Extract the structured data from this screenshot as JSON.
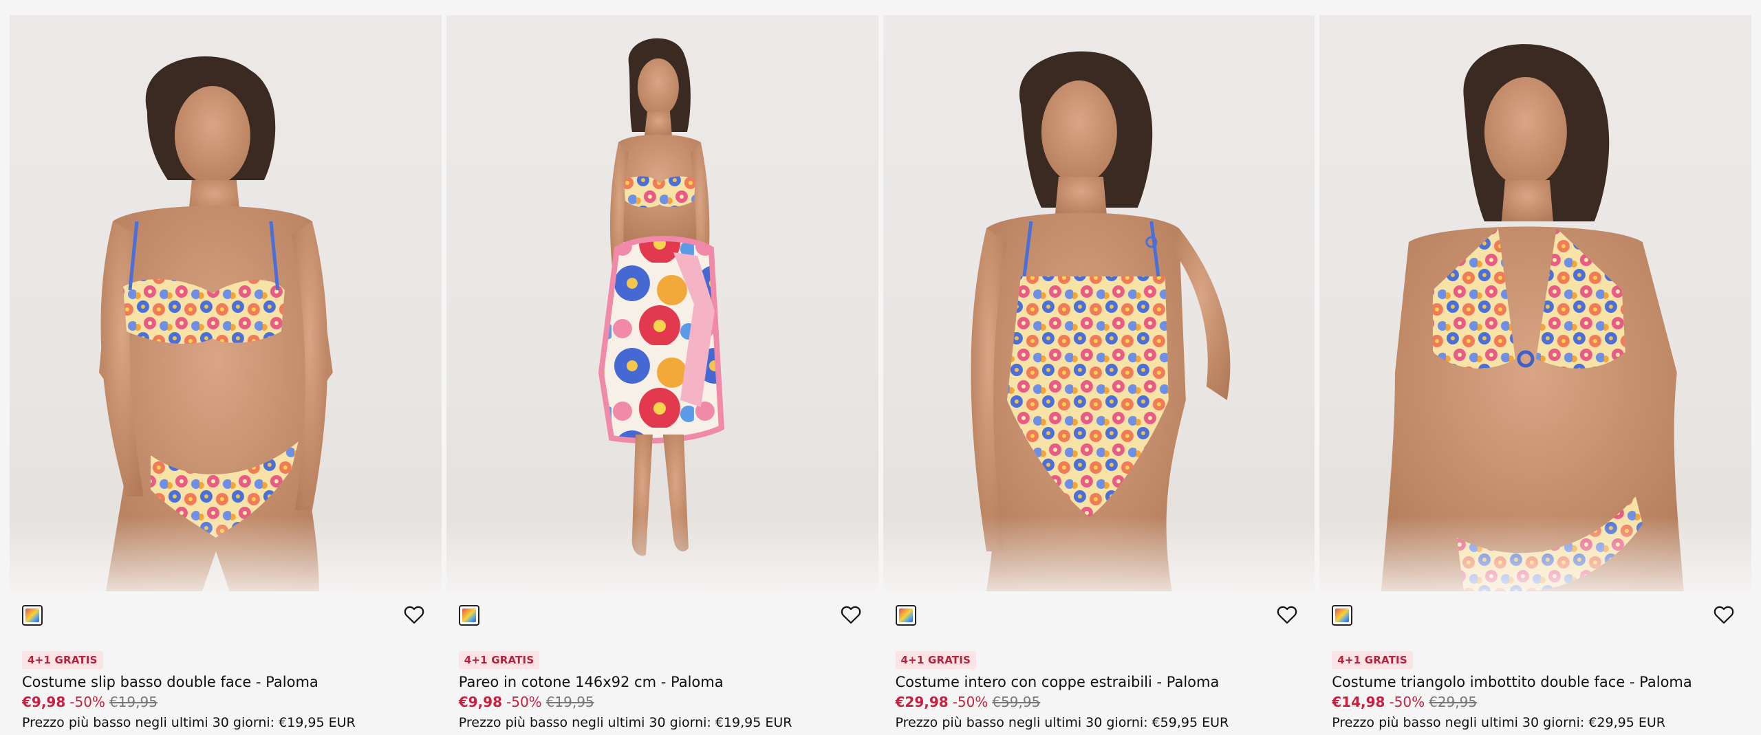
{
  "products": [
    {
      "badge": "4+1 GRATIS",
      "title": "Costume slip basso double face - Paloma",
      "price_now": "€9,98",
      "discount": "-50%",
      "price_old": "€19,95",
      "lowest_price": "Prezzo più basso negli ultimi 30 giorni: €19,95 EUR",
      "swatch_icon": "multicolor-swatch",
      "wishlist_icon": "heart-outline-icon"
    },
    {
      "badge": "4+1 GRATIS",
      "title": "Pareo in cotone 146x92 cm - Paloma",
      "price_now": "€9,98",
      "discount": "-50%",
      "price_old": "€19,95",
      "lowest_price": "Prezzo più basso negli ultimi 30 giorni: €19,95 EUR",
      "swatch_icon": "multicolor-swatch",
      "wishlist_icon": "heart-outline-icon"
    },
    {
      "badge": "4+1 GRATIS",
      "title": "Costume intero con coppe estraibili - Paloma",
      "price_now": "€29,98",
      "discount": "-50%",
      "price_old": "€59,95",
      "lowest_price": "Prezzo più basso negli ultimi 30 giorni: €59,95 EUR",
      "swatch_icon": "multicolor-swatch",
      "wishlist_icon": "heart-outline-icon"
    },
    {
      "badge": "4+1 GRATIS",
      "title": "Costume triangolo imbottito double face - Paloma",
      "price_now": "€14,98",
      "discount": "-50%",
      "price_old": "€29,95",
      "lowest_price": "Prezzo più basso negli ultimi 30 giorni: €29,95 EUR",
      "swatch_icon": "multicolor-swatch",
      "wishlist_icon": "heart-outline-icon"
    }
  ],
  "colors": {
    "background": "#f5f5f5",
    "sale_red": "#c8203e",
    "badge_bg": "#fbe3e6",
    "badge_text": "#b3243b",
    "old_price": "#777777"
  }
}
